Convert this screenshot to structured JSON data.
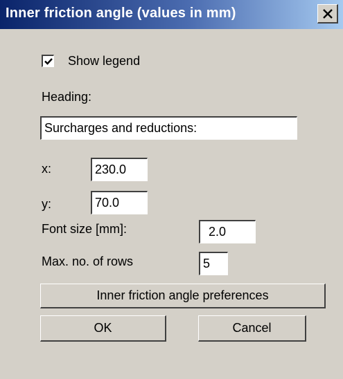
{
  "window": {
    "title": "Inner friction angle (values in mm)",
    "close_icon": "close-icon"
  },
  "legend": {
    "show_label": "Show legend",
    "checked": true
  },
  "heading": {
    "label": "Heading:",
    "value": "Surcharges and reductions:"
  },
  "position": {
    "x_label": "x:",
    "x_value": "230.0",
    "y_label": "y:",
    "y_value": "70.0"
  },
  "font_size": {
    "label": "Font size [mm]:",
    "value": "2.0"
  },
  "max_rows": {
    "label": "Max. no. of rows",
    "value": "5"
  },
  "buttons": {
    "preferences": "Inner friction angle preferences",
    "ok": "OK",
    "cancel": "Cancel"
  },
  "colors": {
    "title_bar": "#0a246a",
    "dialog_bg": "#d4d0c8"
  }
}
